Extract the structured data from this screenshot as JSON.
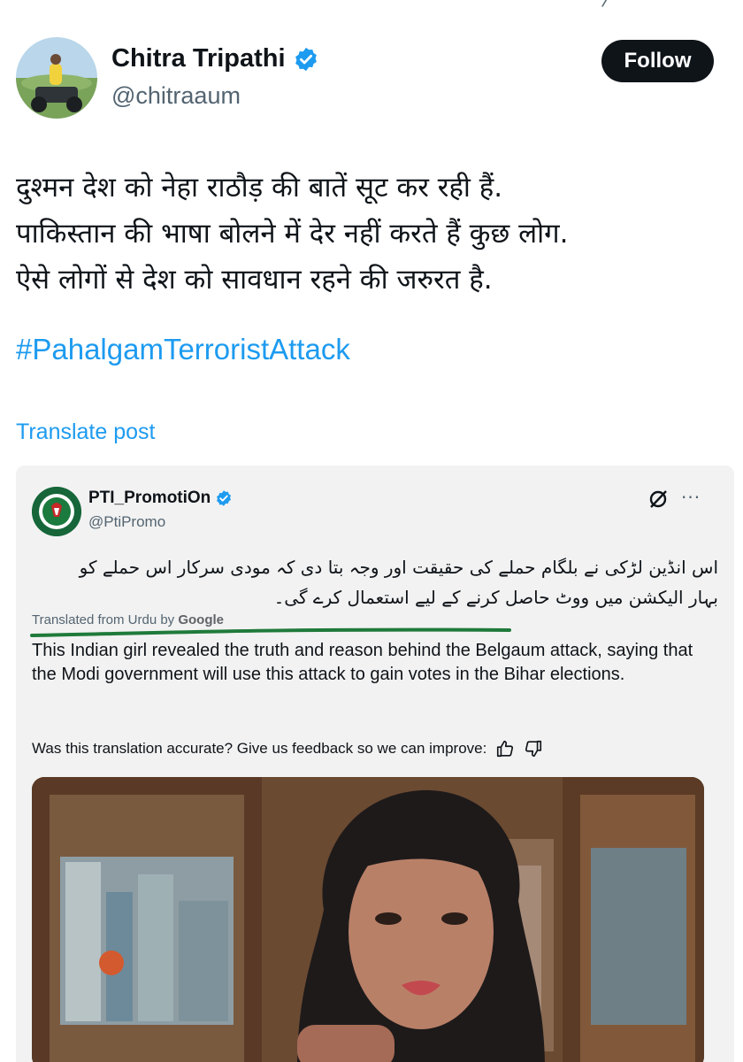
{
  "author": {
    "name": "Chitra Tripathi",
    "handle": "@chitraaum",
    "follow_label": "Follow"
  },
  "post": {
    "lines": [
      "दुश्मन देश को नेहा राठौड़ की बातें सूट कर रही हैं.",
      "पाकिस्तान की भाषा बोलने में देर नहीं करते हैं कुछ लोग.",
      "ऐसे लोगों से देश को सावधान रहने की जरुरत है."
    ],
    "hashtag": "#PahalgamTerroristAttack",
    "translate_label": "Translate post"
  },
  "quoted": {
    "name": "PTI_PromotiOn",
    "handle": "@PtiPromo",
    "urdu_text": "اس انڈین لڑکی نے بلگام حملے کی حقیقت اور وجہ بتا دی کہ مودی سرکار اس حملے کو بہار الیکشن میں ووٹ حاصل کرنے کے لیے استعمال کرے گی۔",
    "translated_from": "Translated from Urdu by",
    "translated_by": "Google",
    "translation": "This Indian girl revealed the truth and reason behind the Belgaum attack, saying that the Modi government will use this attack to gain votes in the Bihar elections.",
    "feedback": "Was this translation accurate? Give us feedback so we can improve:",
    "more_icon": "···"
  },
  "colors": {
    "accent": "#1d9bf0",
    "underline": "#1f7a3a",
    "text": "#0f1419",
    "muted": "#536471"
  },
  "icons": [
    "verified-badge-icon",
    "grok-icon",
    "more-icon",
    "thumbs-up-icon",
    "thumbs-down-icon"
  ]
}
